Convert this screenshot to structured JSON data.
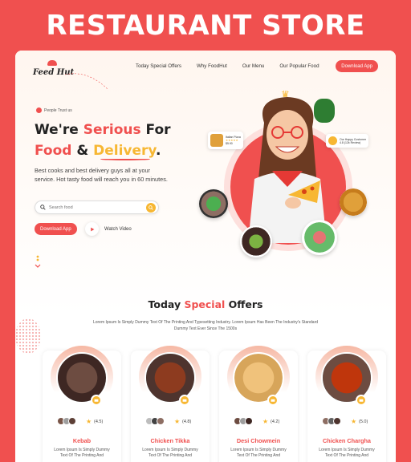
{
  "banner": {
    "title": "RESTAURANT STORE"
  },
  "nav": {
    "logo": "Feed Hut",
    "links": [
      "Today Special Offers",
      "Why FoodHut",
      "Our Menu",
      "Our Popular Food"
    ],
    "cta": "Download App"
  },
  "hero": {
    "trust_badge": "People Trust us",
    "headline_line1_a": "We're ",
    "headline_line1_b": "Serious",
    "headline_line1_c": " For",
    "headline_line2_a": "Food",
    "headline_line2_b": " & ",
    "headline_line2_c": "Delivery",
    "headline_line2_d": ".",
    "description": "Best cooks and best delivery guys all at your service. Hot tasty food will reach you in 60 minutes.",
    "search_placeholder": "Search food",
    "download_button": "Download App",
    "watch_video": "Watch Video",
    "pizza_card": {
      "name": "Italian Pizza",
      "price": "$5.90"
    },
    "customers_card": {
      "title": "Our Happy Customer",
      "rating": "4.8 (12k Review)"
    }
  },
  "specials": {
    "title_a": "Today ",
    "title_b": "Special",
    "title_c": " Offers",
    "subtitle": "Lorem Ipsum Is Simply Dummy Text Of The Printing And Typesetting Industry. Lorem Ipsum Has Been The Industry's Standard Dummy Text Ever Since The 1500s",
    "items": [
      {
        "name": "Kebab",
        "rating": "(4.5)",
        "desc": "Lorem Ipsum Is Simply Dummy Text Of The Printing And"
      },
      {
        "name": "Chicken Tikka",
        "rating": "(4.8)",
        "desc": "Lorem Ipsum Is Simply Dummy Text Of The Printing And"
      },
      {
        "name": "Desi Chowmein",
        "rating": "(4.2)",
        "desc": "Lorem Ipsum Is Simply Dummy Text Of The Printing And"
      },
      {
        "name": "Chicken Chargha",
        "rating": "(5.0)",
        "desc": "Lorem Ipsum Is Simply Dummy Text Of The Printing And"
      }
    ]
  },
  "colors": {
    "brand": "#f0504f",
    "accent": "#f7b733"
  }
}
